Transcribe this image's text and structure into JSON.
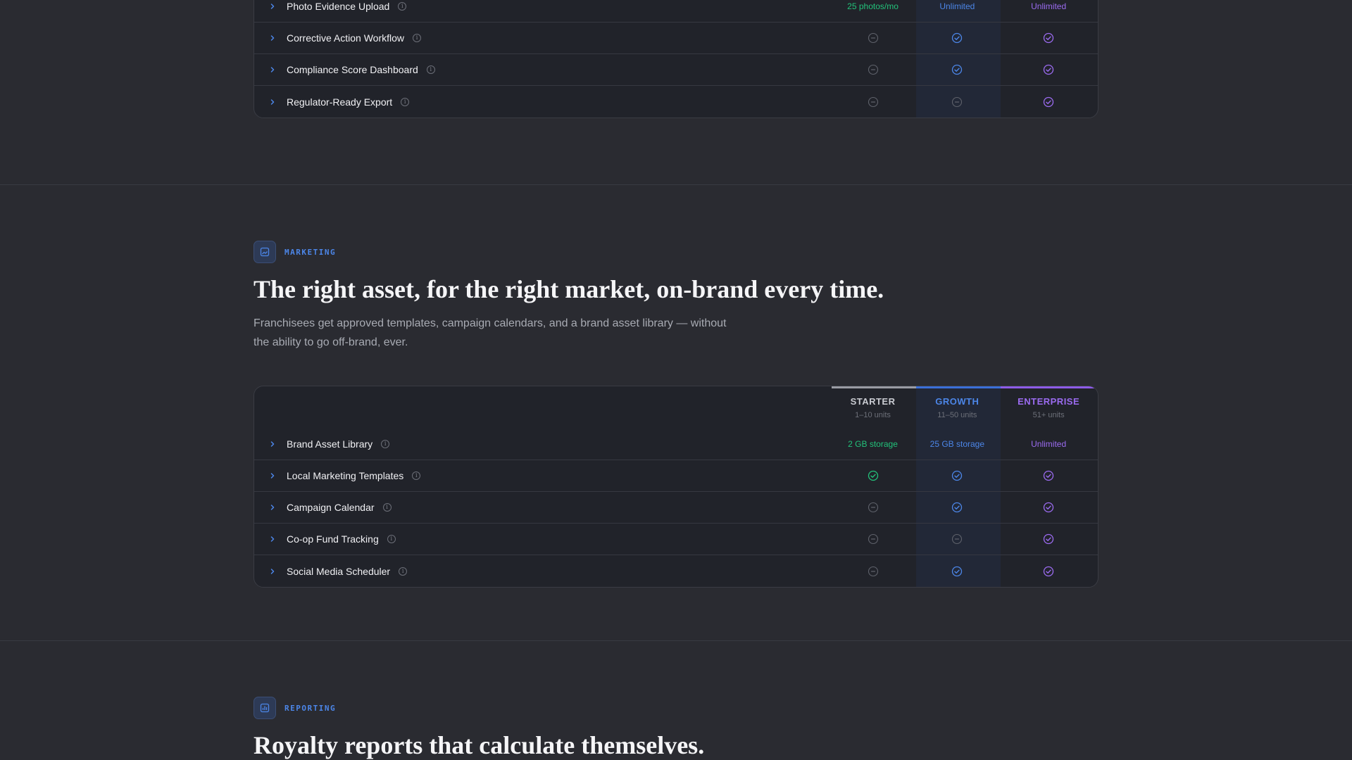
{
  "compliance": {
    "rows": [
      {
        "label": "Photo Evidence Upload",
        "starter": "25 photos/mo",
        "growth": "Unlimited",
        "enterprise": "Unlimited"
      },
      {
        "label": "Corrective Action Workflow",
        "starter": "no",
        "growth": "yes",
        "enterprise": "yes"
      },
      {
        "label": "Compliance Score Dashboard",
        "starter": "no",
        "growth": "yes",
        "enterprise": "yes"
      },
      {
        "label": "Regulator-Ready Export",
        "starter": "no",
        "growth": "no",
        "enterprise": "yes"
      }
    ]
  },
  "marketing": {
    "badge_label": "MARKETING",
    "badge_icon": "image-icon",
    "heading": "The right asset, for the right market, on-brand every time.",
    "subtext": "Franchisees get approved templates, campaign calendars, and a brand asset library — without the ability to go off-brand, ever.",
    "plans": [
      {
        "name": "STARTER",
        "units": "1–10 units",
        "color": "#c9cbd1",
        "bar": "#9a9ca4"
      },
      {
        "name": "GROWTH",
        "units": "11–50 units",
        "color": "#4c86e8",
        "bar": "#3b6fd8"
      },
      {
        "name": "ENTERPRISE",
        "units": "51+ units",
        "color": "#9b6bf0",
        "bar": "#8e5ce8"
      }
    ],
    "rows": [
      {
        "label": "Brand Asset Library",
        "starter": "2 GB storage",
        "growth": "25 GB storage",
        "enterprise": "Unlimited"
      },
      {
        "label": "Local Marketing Templates",
        "starter": "yes",
        "growth": "yes",
        "enterprise": "yes"
      },
      {
        "label": "Campaign Calendar",
        "starter": "no",
        "growth": "yes",
        "enterprise": "yes"
      },
      {
        "label": "Co-op Fund Tracking",
        "starter": "no",
        "growth": "no",
        "enterprise": "yes"
      },
      {
        "label": "Social Media Scheduler",
        "starter": "no",
        "growth": "yes",
        "enterprise": "yes"
      }
    ]
  },
  "reporting": {
    "badge_label": "REPORTING",
    "badge_icon": "bar-chart-icon",
    "heading": "Royalty reports that calculate themselves."
  },
  "colors": {
    "starter": "#22c27a",
    "growth": "#4c86e8",
    "enterprise": "#9b6bf0",
    "muted": "#5f626b"
  }
}
